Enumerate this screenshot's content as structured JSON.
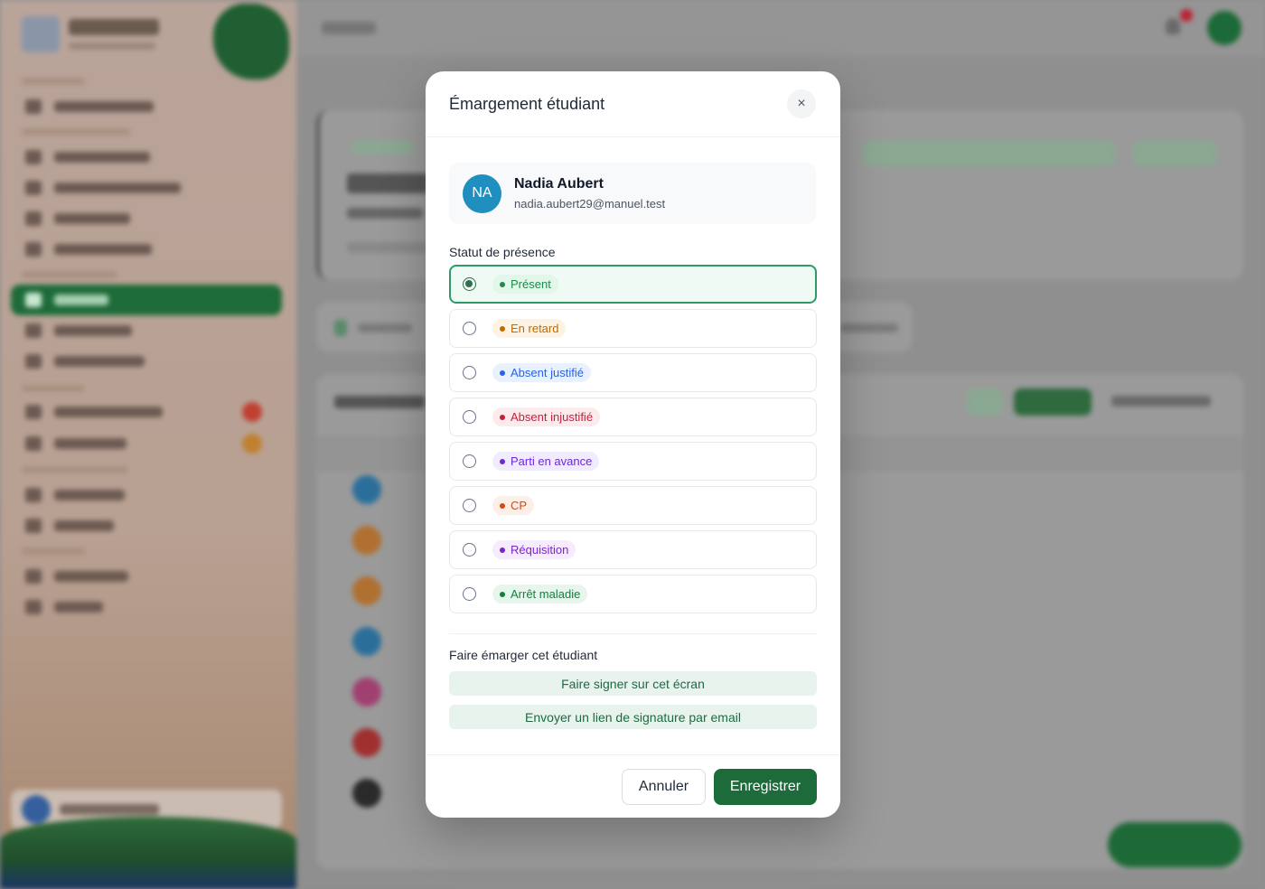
{
  "modal": {
    "title": "Émargement étudiant",
    "student": {
      "initials": "NA",
      "name": "Nadia Aubert",
      "email": "nadia.aubert29@manuel.test"
    },
    "status_label": "Statut de présence",
    "options": [
      {
        "label": "Présent",
        "selected": true,
        "color": "#1f8a4c",
        "bg": "#e3f6ea"
      },
      {
        "label": "En retard",
        "selected": false,
        "color": "#c26a00",
        "bg": "#fdf3e3"
      },
      {
        "label": "Absent justifié",
        "selected": false,
        "color": "#2563eb",
        "bg": "#eaf1fe"
      },
      {
        "label": "Absent injustifié",
        "selected": false,
        "color": "#c81e3a",
        "bg": "#fdeaec"
      },
      {
        "label": "Parti en avance",
        "selected": false,
        "color": "#6d28d9",
        "bg": "#f1ecfd"
      },
      {
        "label": "CP",
        "selected": false,
        "color": "#d9480f",
        "bg": "#fdeee6"
      },
      {
        "label": "Réquisition",
        "selected": false,
        "color": "#7e22ce",
        "bg": "#f5ecfd"
      },
      {
        "label": "Arrêt maladie",
        "selected": false,
        "color": "#15803d",
        "bg": "#e6f6ec"
      }
    ],
    "sign_label": "Faire émarger cet étudiant",
    "sign_screen": "Faire signer sur cet écran",
    "sign_email": "Envoyer un lien de signature par email",
    "cancel": "Annuler",
    "save": "Enregistrer",
    "close_icon": "×"
  }
}
